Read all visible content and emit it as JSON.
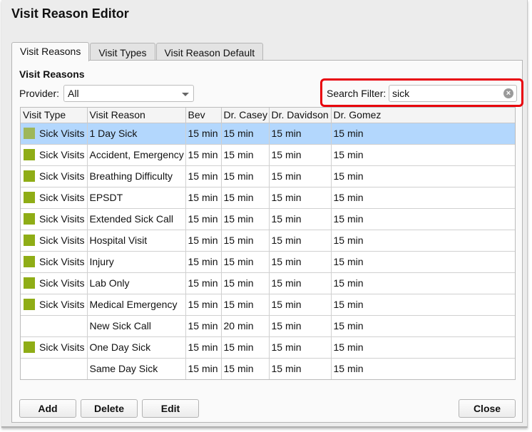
{
  "window": {
    "title": "Visit Reason Editor"
  },
  "tabs": [
    {
      "label": "Visit Reasons",
      "active": true
    },
    {
      "label": "Visit Types"
    },
    {
      "label": "Visit Reason Default"
    }
  ],
  "section_title": "Visit Reasons",
  "provider": {
    "label": "Provider:",
    "value": "All"
  },
  "search": {
    "label": "Search Filter:",
    "value": "sick",
    "highlighted": true,
    "highlight_color": "#e8000b"
  },
  "colors": {
    "swatch": "#8fad16",
    "swatch_selected": "#9eb75a",
    "selected_row": "#b3d7fd"
  },
  "table": {
    "columns": [
      "Visit Type",
      "Visit Reason",
      "Bev",
      "Dr. Casey",
      "Dr. Davidson",
      "Dr. Gomez"
    ],
    "rows": [
      {
        "type": "Sick Visits",
        "reason": "1 Day Sick",
        "times": [
          "15 min",
          "15 min",
          "15 min",
          "15 min"
        ],
        "selected": true
      },
      {
        "type": "Sick Visits",
        "reason": "Accident, Emergency",
        "times": [
          "15 min",
          "15 min",
          "15 min",
          "15 min"
        ]
      },
      {
        "type": "Sick Visits",
        "reason": "Breathing Difficulty",
        "times": [
          "15 min",
          "15 min",
          "15 min",
          "15 min"
        ]
      },
      {
        "type": "Sick Visits",
        "reason": "EPSDT",
        "times": [
          "15 min",
          "15 min",
          "15 min",
          "15 min"
        ]
      },
      {
        "type": "Sick Visits",
        "reason": "Extended Sick Call",
        "times": [
          "15 min",
          "15 min",
          "15 min",
          "15 min"
        ]
      },
      {
        "type": "Sick Visits",
        "reason": "Hospital Visit",
        "times": [
          "15 min",
          "15 min",
          "15 min",
          "15 min"
        ]
      },
      {
        "type": "Sick Visits",
        "reason": "Injury",
        "times": [
          "15 min",
          "15 min",
          "15 min",
          "15 min"
        ]
      },
      {
        "type": "Sick Visits",
        "reason": "Lab Only",
        "times": [
          "15 min",
          "15 min",
          "15 min",
          "15 min"
        ]
      },
      {
        "type": "Sick Visits",
        "reason": "Medical Emergency",
        "times": [
          "15 min",
          "15 min",
          "15 min",
          "15 min"
        ]
      },
      {
        "type": "",
        "reason": "New Sick Call",
        "times": [
          "15 min",
          "20 min",
          "15 min",
          "15 min"
        ]
      },
      {
        "type": "Sick Visits",
        "reason": "One Day Sick",
        "times": [
          "15 min",
          "15 min",
          "15 min",
          "15 min"
        ]
      },
      {
        "type": "",
        "reason": "Same Day Sick",
        "times": [
          "15 min",
          "15 min",
          "15 min",
          "15 min"
        ]
      }
    ]
  },
  "buttons": {
    "add": "Add",
    "delete": "Delete",
    "edit": "Edit",
    "close": "Close"
  }
}
